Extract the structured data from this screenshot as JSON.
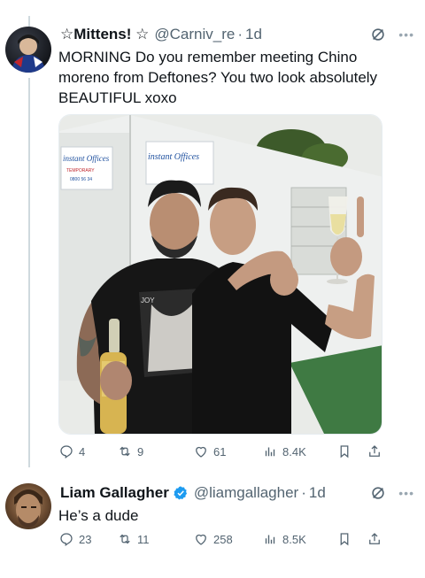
{
  "tweets": [
    {
      "name": "☆Mittens! ☆",
      "handle": "@Carniv_re",
      "time": "1d",
      "text": "MORNING Do you remember meeting Chino moreno from Deftones? You two look absolutely BEAUTIFUL xoxo",
      "actions": {
        "replies": "4",
        "reposts": "9",
        "likes": "61",
        "views": "8.4K"
      }
    },
    {
      "name": "Liam Gallagher",
      "handle": "@liamgallagher",
      "time": "1d",
      "text": "He’s a dude",
      "actions": {
        "replies": "23",
        "reposts": "11",
        "likes": "258",
        "views": "8.5K"
      }
    }
  ],
  "photo": {
    "signs": [
      "instant Offices",
      "instant Offices"
    ],
    "sign_small": [
      "TEMPORARY",
      "0800 56 34"
    ],
    "shirt_text": "JOY"
  },
  "colors": {
    "text": "#0f1419",
    "secondary": "#536471",
    "accent": "#1d9bf0",
    "line": "#cfd9de"
  },
  "icons": [
    "reply-icon",
    "repost-icon",
    "like-icon",
    "views-icon",
    "bookmark-icon",
    "share-icon",
    "grok-icon",
    "more-icon",
    "verified-icon"
  ]
}
